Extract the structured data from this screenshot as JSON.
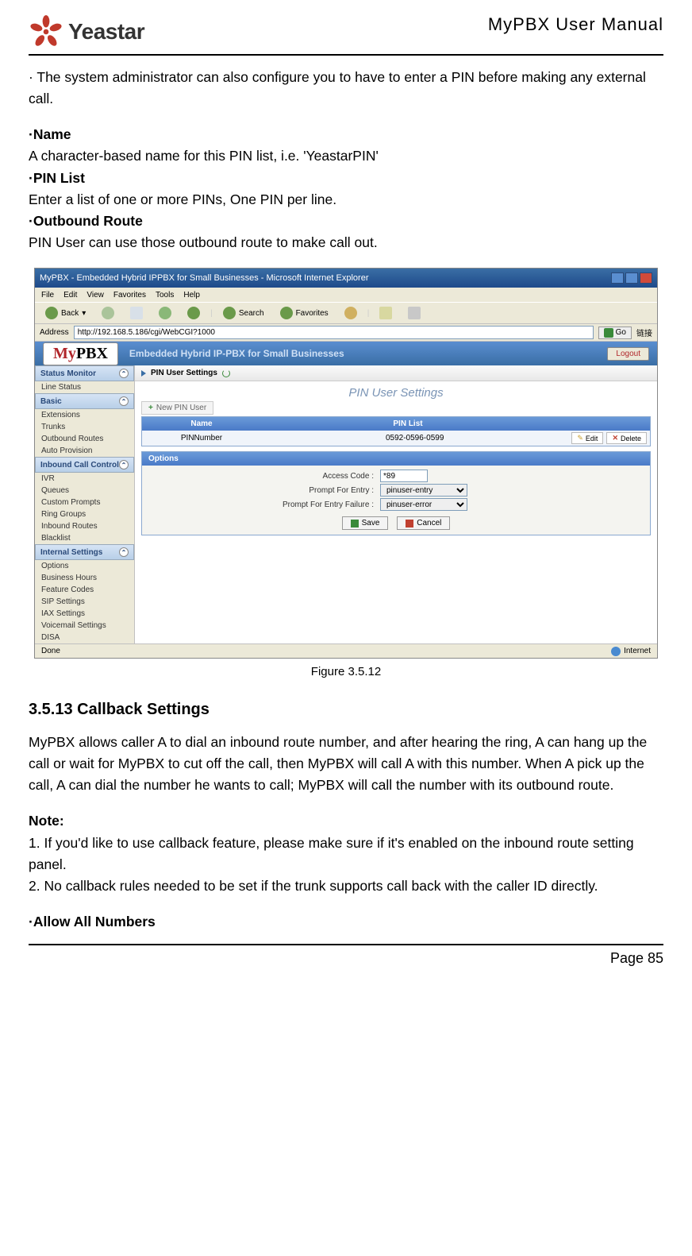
{
  "header": {
    "logo_brand": "Yeastar",
    "manual_title": "MyPBX User Manual"
  },
  "intro_bullet": "· The system administrator can also configure you to have to enter a PIN before making any external call.",
  "fields": {
    "name_label": "·Name",
    "name_desc": "A character-based name for this PIN list, i.e. 'YeastarPIN'",
    "pinlist_label": "·PIN List",
    "pinlist_desc": "Enter a list of one or more PINs, One PIN per line.",
    "outbound_label": "·Outbound Route",
    "outbound_desc": "PIN User can use those outbound route to make call out."
  },
  "screenshot": {
    "window_title": "MyPBX - Embedded Hybrid IPPBX for Small Businesses - Microsoft Internet Explorer",
    "menu": [
      "File",
      "Edit",
      "View",
      "Favorites",
      "Tools",
      "Help"
    ],
    "toolbar": {
      "back": "Back",
      "search": "Search",
      "favorites": "Favorites"
    },
    "address_label": "Address",
    "address_url": "http://192.168.5.186/cgi/WebCGI?1000",
    "go": "Go",
    "links": "链接",
    "app_logo": "MyPBX",
    "app_tag": "Embedded Hybrid IP-PBX for Small Businesses",
    "logout": "Logout",
    "sidebar": {
      "status_head": "Status Monitor",
      "status_items": [
        "Line Status"
      ],
      "basic_head": "Basic",
      "basic_items": [
        "Extensions",
        "Trunks",
        "Outbound Routes",
        "Auto Provision"
      ],
      "inbound_head": "Inbound Call Control",
      "inbound_items": [
        "IVR",
        "Queues",
        "Custom Prompts",
        "Ring Groups",
        "Inbound Routes",
        "Blacklist"
      ],
      "internal_head": "Internal Settings",
      "internal_items": [
        "Options",
        "Business Hours",
        "Feature Codes",
        "SIP Settings",
        "IAX Settings",
        "Voicemail Settings",
        "DISA"
      ]
    },
    "breadcrumb": "PIN User Settings",
    "page_title": "PIN User Settings",
    "new_btn": "New PIN User",
    "table": {
      "col_name": "Name",
      "col_pinlist": "PIN List",
      "row_name": "PINNumber",
      "row_pinlist": "0592-0596-0599",
      "edit": "Edit",
      "delete": "Delete"
    },
    "options": {
      "head": "Options",
      "access_code_lbl": "Access Code :",
      "access_code_val": "*89",
      "prompt_entry_lbl": "Prompt For Entry :",
      "prompt_entry_val": "pinuser-entry",
      "prompt_fail_lbl": "Prompt For Entry Failure :",
      "prompt_fail_val": "pinuser-error",
      "save": "Save",
      "cancel": "Cancel"
    },
    "status_done": "Done",
    "status_net": "Internet"
  },
  "figure_caption": "Figure 3.5.12",
  "section_3513": {
    "heading": "3.5.13 Callback Settings",
    "para": "MyPBX allows caller A to dial an inbound route number, and after hearing the ring, A can hang up the call or wait for MyPBX to cut off the call, then MyPBX will call A with this number. When A pick up the call, A can dial the number he wants to call; MyPBX will call the number with its outbound route.",
    "note_label": "Note:",
    "note1": "1. If you'd like to use callback feature, please make sure if it's enabled on the inbound route setting panel.",
    "note2": "2. No callback rules needed to be set if the trunk supports call back with the caller ID directly.",
    "allow": "·Allow All Numbers"
  },
  "footer": {
    "page": "Page 85"
  }
}
